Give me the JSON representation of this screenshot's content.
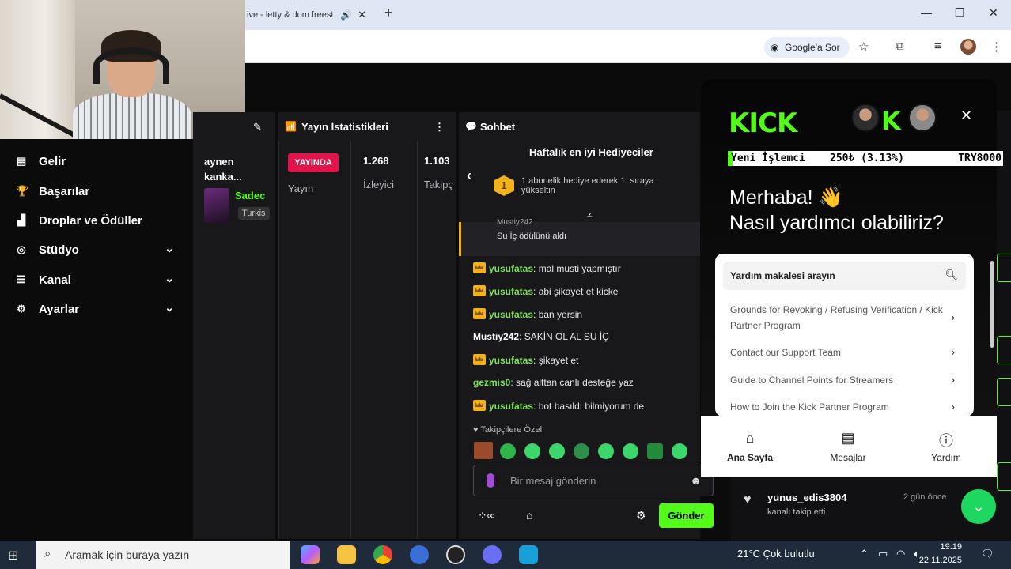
{
  "browser": {
    "tab_title": "ive - letty & dom freest",
    "google_search_label": "Google'a Sor"
  },
  "sidebar": {
    "items": [
      {
        "label": "Gelir",
        "icon": "wallet-icon",
        "has_chevron": false
      },
      {
        "label": "Başarılar",
        "icon": "trophy-icon",
        "has_chevron": false
      },
      {
        "label": "Droplar ve Ödüller",
        "icon": "drops-icon",
        "has_chevron": false
      },
      {
        "label": "Stüdyo",
        "icon": "studio-icon",
        "has_chevron": true
      },
      {
        "label": "Kanal",
        "icon": "channel-icon",
        "has_chevron": true
      },
      {
        "label": "Ayarlar",
        "icon": "gear-icon",
        "has_chevron": true
      }
    ]
  },
  "col1": {
    "title": "aynen kanka...",
    "user": "Sadec",
    "tag": "Turkis"
  },
  "stats_panel": {
    "title": "Yayın İstatistikleri",
    "live_badge": "YAYINDA",
    "live_label": "Yayın",
    "viewers_value": "1.268",
    "viewers_label": "İzleyici",
    "followers_value": "1.103",
    "followers_label": "Takipç"
  },
  "chat": {
    "title": "Sohbet",
    "gifters_title": "Haftalık en iyi Hediyeciler",
    "rank": "1",
    "gift_desc": "1 abonelik hediye ederek 1. sıraya yükseltin",
    "redeem_user": "Mustiy242",
    "redeem_text": "Su İç ödülünü aldı",
    "messages": [
      {
        "user": "yusufatas",
        "text": ": mal musti yapmıştır",
        "crown": true
      },
      {
        "user": "yusufatas",
        "text": ": abi şikayet et kicke",
        "crown": true
      },
      {
        "user": "yusufatas",
        "text": ": ban yersin",
        "crown": true
      },
      {
        "user": "Mustiy242",
        "text": ": SAKİN OL AL SU İÇ",
        "crown": false
      },
      {
        "user": "yusufatas",
        "text": ": şikayet et",
        "crown": true
      },
      {
        "user": "gezmis0",
        "text": ": sağ alttan canlı desteğe yaz",
        "crown": false
      },
      {
        "user": "yusufatas",
        "text": ": bot basıldı bilmiyorum de",
        "crown": true
      }
    ],
    "followers_only": "Takipçilere Özel",
    "input_placeholder": "Bir mesaj gönderin",
    "send_label": "Gönder"
  },
  "help_widget": {
    "logo": "KICK",
    "ticker_left": "Yeni İşlemci",
    "ticker_mid": "250₺ (3.13%)",
    "ticker_right": "TRY8000",
    "greeting_line1": "Merhaba! 👋",
    "greeting_line2": "Nasıl yardımcı olabiliriz?",
    "search_placeholder": "Yardım makalesi arayın",
    "links": [
      "Grounds for Revoking / Refusing Verification / Kick Partner Program",
      "Contact our Support Team",
      "Guide to Channel Points for Streamers",
      "How to Join the Kick Partner Program"
    ],
    "nav": [
      {
        "label": "Ana Sayfa",
        "icon": "home-icon"
      },
      {
        "label": "Mesajlar",
        "icon": "messages-icon"
      },
      {
        "label": "Yardım",
        "icon": "help-icon"
      }
    ]
  },
  "notification": {
    "user": "yunus_edis3804",
    "time": "2 gün önce",
    "message": "kanalı takip etti"
  },
  "taskbar": {
    "search_placeholder": "Aramak için buraya yazın",
    "weather": "21°C  Çok bulutlu",
    "time": "19:19",
    "date": "22.11.2025"
  },
  "colors": {
    "kick_green": "#53fc18",
    "live_red": "#e1144b",
    "panel": "#18181b",
    "background": "#0b0b0c"
  }
}
